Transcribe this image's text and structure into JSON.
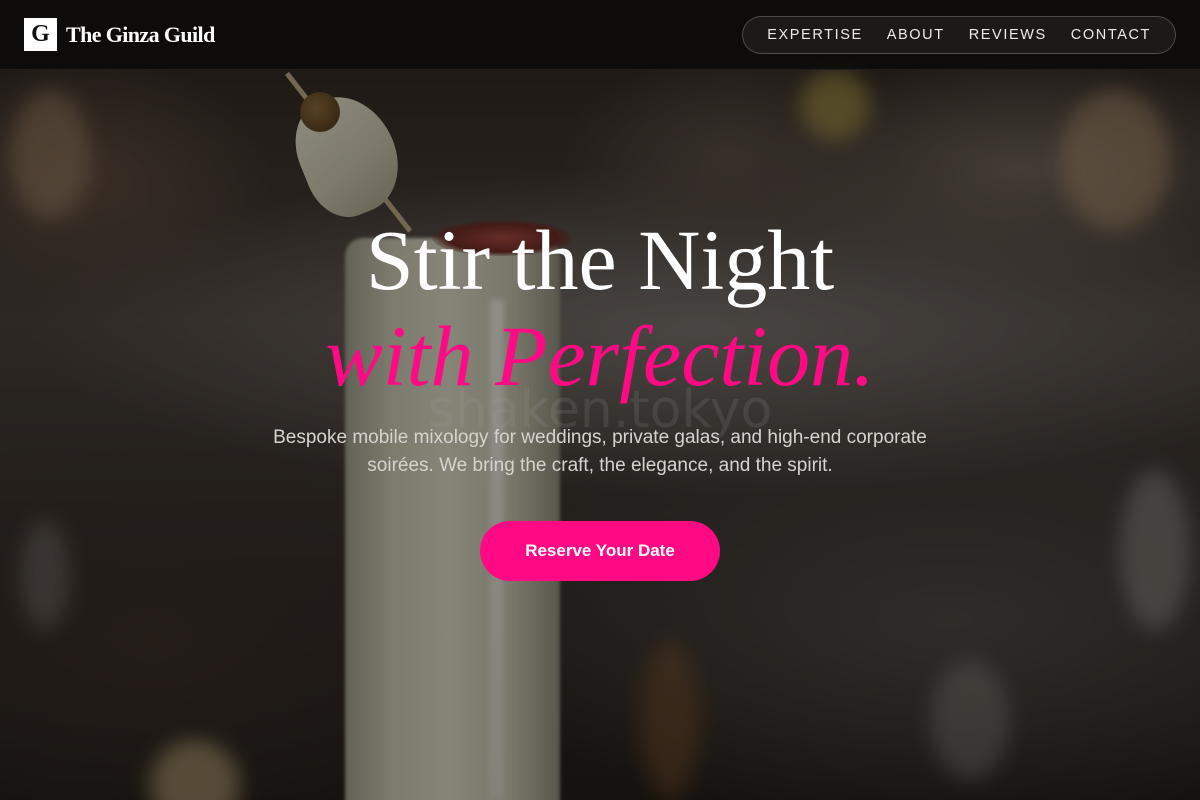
{
  "header": {
    "logo_letter": "G",
    "brand_name": "The Ginza Guild",
    "nav": [
      {
        "label": "EXPERTISE"
      },
      {
        "label": "ABOUT"
      },
      {
        "label": "REVIEWS"
      },
      {
        "label": "CONTACT"
      }
    ]
  },
  "hero": {
    "title_line1": "Stir the Night",
    "title_line2": "with Perfection.",
    "subtitle": "Bespoke mobile mixology for weddings, private galas, and high-end corporate soirées. We bring the craft, the elegance, and the spirit.",
    "cta_label": "Reserve Your Date",
    "background_watermark": "shaken.tokyo",
    "background_image": "blurred-cocktail-bar-icon"
  },
  "colors": {
    "accent": "#ff0a84",
    "text": "#ffffff",
    "subtitle": "#d6d3cf",
    "header_bg": "#0c0a09"
  }
}
